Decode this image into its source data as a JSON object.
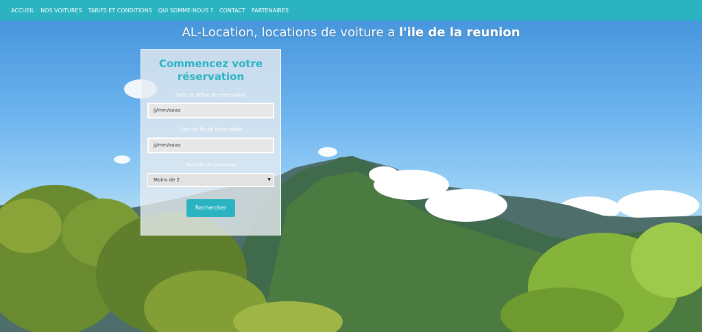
{
  "nav": {
    "items": [
      {
        "label": "ACCUEIL"
      },
      {
        "label": "NOS VOITURES"
      },
      {
        "label": "TARIFS ET CONDITIONS"
      },
      {
        "label": "QUI SOMME-NOUS ?"
      },
      {
        "label": "CONTACT"
      },
      {
        "label": "PARTENAIRES"
      }
    ]
  },
  "hero": {
    "headline_part1": "AL-Location, locations de voiture a ",
    "headline_part2": "l'ile de la reunion"
  },
  "form": {
    "title": "Commencez votre réservation",
    "start_label": "Date de début de réservation",
    "start_placeholder": "jj/mm/aaaa",
    "end_label": "Date de fin de réservation",
    "end_placeholder": "jj/mm/aaaa",
    "people_label": "Nombre de personne",
    "people_selected": "Moins de 2",
    "submit_label": "Rechercher"
  },
  "colors": {
    "accent": "#2bb3c2",
    "sky": "#6db4ef"
  }
}
